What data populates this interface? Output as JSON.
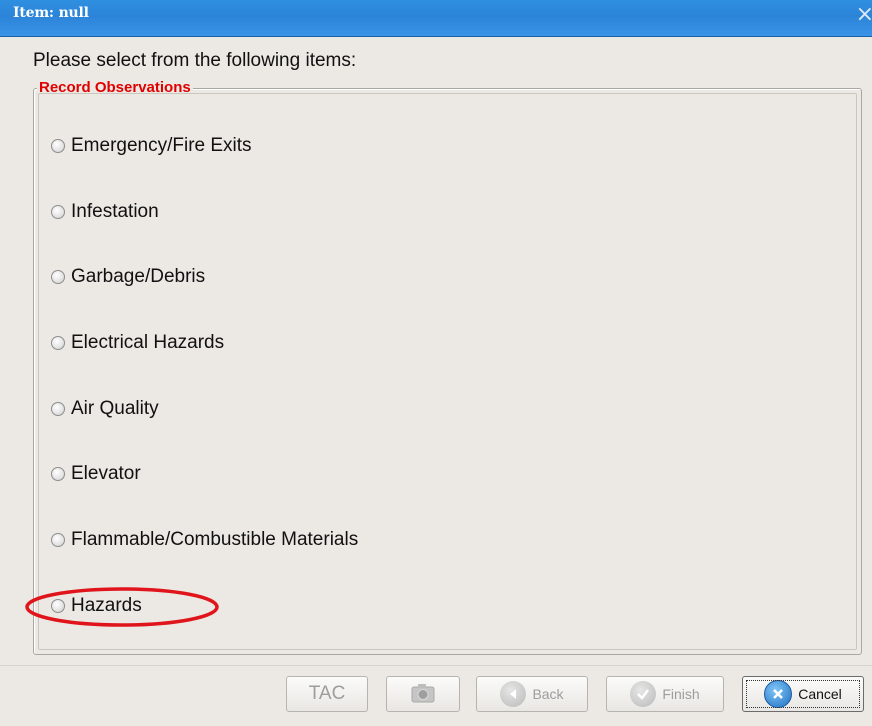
{
  "window": {
    "title": "Item: null",
    "close_glyph": "×"
  },
  "prompt": "Please select from the following items:",
  "group": {
    "legend": "Record Observations",
    "legend_color": "#e00000",
    "items": [
      {
        "label": "Emergency/Fire Exits",
        "selected": false
      },
      {
        "label": "Infestation",
        "selected": false
      },
      {
        "label": "Garbage/Debris",
        "selected": false
      },
      {
        "label": "Electrical Hazards",
        "selected": false
      },
      {
        "label": "Air Quality",
        "selected": false
      },
      {
        "label": "Elevator",
        "selected": false
      },
      {
        "label": "Flammable/Combustible Materials",
        "selected": false
      },
      {
        "label": "Hazards",
        "selected": false,
        "highlighted": true
      }
    ]
  },
  "highlight_color": "#e0151b",
  "buttons": {
    "tac": "TAC",
    "camera_icon": "camera-icon",
    "back": "Back",
    "finish": "Finish",
    "cancel": "Cancel"
  }
}
